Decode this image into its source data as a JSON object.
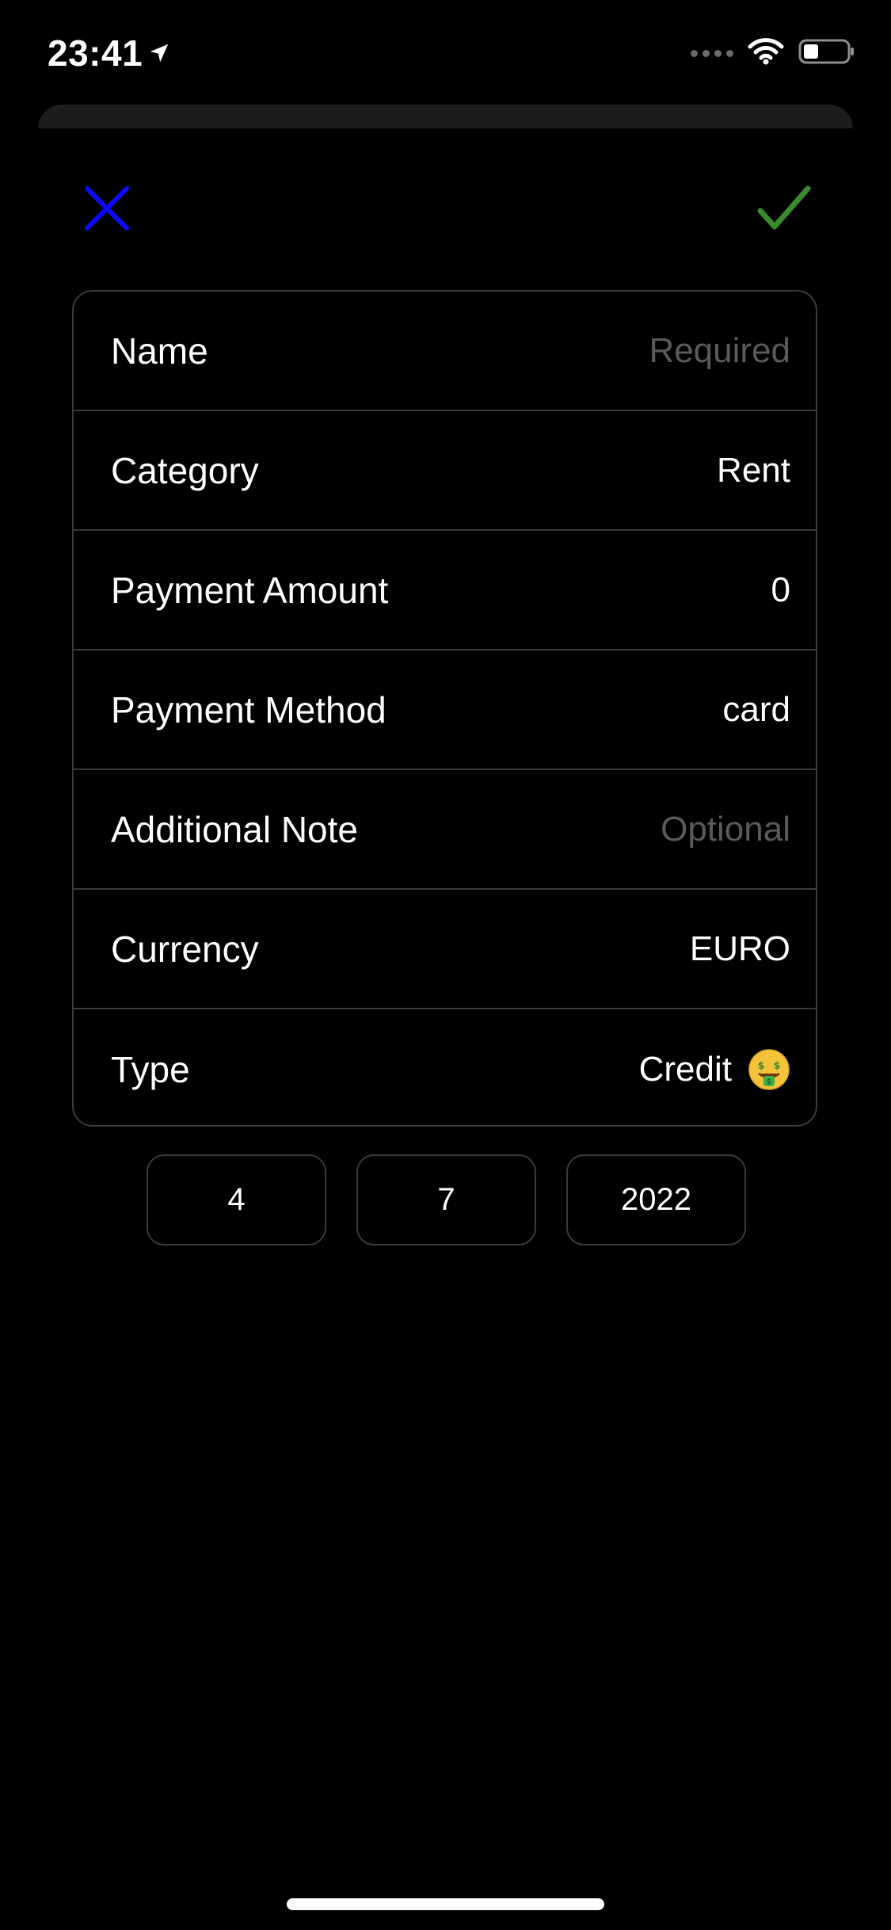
{
  "status_bar": {
    "time": "23:41"
  },
  "form": {
    "rows": [
      {
        "label": "Name",
        "value": "Required",
        "is_placeholder": true
      },
      {
        "label": "Category",
        "value": "Rent",
        "is_placeholder": false
      },
      {
        "label": "Payment Amount",
        "value": "0",
        "is_placeholder": false
      },
      {
        "label": "Payment Method",
        "value": "card",
        "is_placeholder": false
      },
      {
        "label": "Additional Note",
        "value": "Optional",
        "is_placeholder": true
      },
      {
        "label": "Currency",
        "value": "EURO",
        "is_placeholder": false
      },
      {
        "label": "Type",
        "value": "Credit",
        "icon": "money-mouth-face-icon",
        "is_placeholder": false
      }
    ]
  },
  "date": {
    "day": "4",
    "month": "7",
    "year": "2022"
  },
  "icons": {
    "close": "close-icon",
    "confirm": "checkmark-icon",
    "location": "location-arrow-icon",
    "wifi": "wifi-icon",
    "battery": "battery-icon",
    "signal": "signal-icon"
  },
  "colors": {
    "background": "#000000",
    "close_accent": "#0a0aff",
    "confirm_accent": "#3a8a2e",
    "border": "#3a3a3c",
    "placeholder": "#5a5a5e"
  }
}
